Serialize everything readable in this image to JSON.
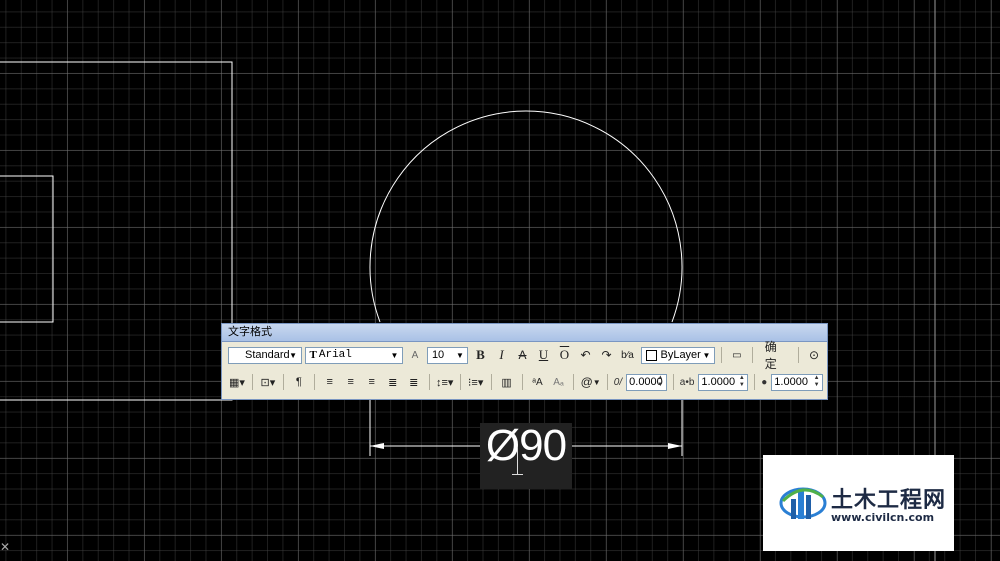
{
  "dimension": {
    "text": "Ø90"
  },
  "toolbar": {
    "title": "文字格式",
    "style_value": "Standard",
    "font_value": "Arial",
    "height_value": "10",
    "bold_label": "B",
    "italic_label": "I",
    "underline_label": "U",
    "overline_label": "O",
    "color_value": "ByLayer",
    "ok_label": "确定",
    "oblique_value": "0.0000",
    "tracking_value": "1.0000",
    "width_value": "1.0000",
    "symbol_label": "@",
    "icons": [
      "text-height-icon",
      "strikethrough-icon",
      "undo-icon",
      "redo-icon",
      "stack-icon",
      "ruler-icon",
      "options-icon",
      "columns-icon",
      "mtext-justify-icon",
      "paragraph-icon",
      "align-left-icon",
      "align-center-icon",
      "align-right-icon",
      "justify-icon",
      "distribute-icon",
      "line-spacing-icon",
      "numbering-icon",
      "insert-field-icon",
      "uppercase-icon",
      "lowercase-icon",
      "symbol-icon",
      "oblique-icon",
      "tracking-icon",
      "width-factor-icon"
    ]
  },
  "watermark": {
    "title": "土木工程网",
    "url": "www.civilcn.com"
  },
  "colors": {
    "canvas": "#000000",
    "geometry": "#ffffff",
    "toolbar_bg": "#ece9d8",
    "title_bar": "#b6cbea",
    "watermark_text": "#1d2a44",
    "logo_blue": "#2a7fd4"
  }
}
